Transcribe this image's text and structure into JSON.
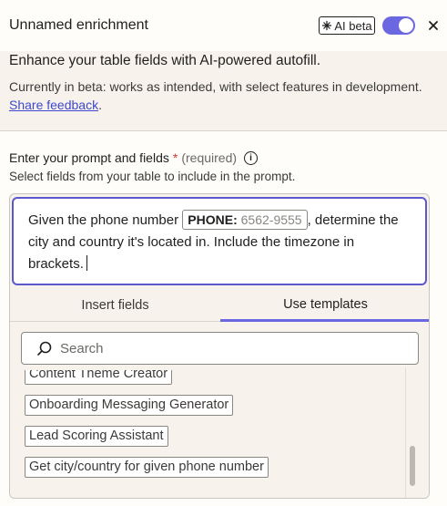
{
  "header": {
    "title": "Unnamed enrichment",
    "ai_badge": "AI beta",
    "toggle_state": "on"
  },
  "intro": {
    "heading": "Enhance your table fields with AI-powered autofill.",
    "desc": "Currently in beta: works as intended, with select features in development.",
    "link": "Share feedback",
    "link_suffix": "."
  },
  "prompt": {
    "label": "Enter your prompt and fields",
    "required_star": "*",
    "required_text": "(required)",
    "sublabel": "Select fields from your table to include in the prompt.",
    "text_before": "Given the phone number",
    "chip_key": "PHONE:",
    "chip_value": "6562-9555",
    "text_after": ", determine the city and country it's located in. Include the timezone in brackets."
  },
  "tabs": [
    {
      "label": "Insert fields",
      "active": false
    },
    {
      "label": "Use templates",
      "active": true
    }
  ],
  "search": {
    "placeholder": "Search"
  },
  "templates": [
    "Content Theme Creator",
    "Onboarding Messaging Generator",
    "Lead Scoring Assistant",
    "Get city/country for given phone number"
  ],
  "colors": {
    "accent": "#6b67e0",
    "link": "#3f48cc",
    "required": "#d5362d"
  }
}
